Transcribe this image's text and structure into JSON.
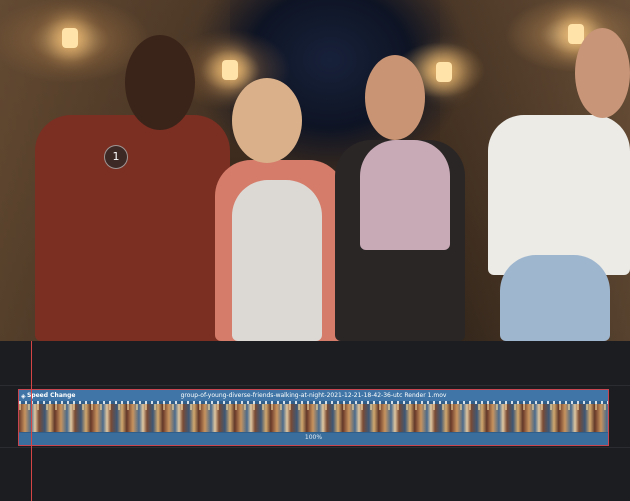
{
  "viewer": {
    "marker_label": "1"
  },
  "timeline": {
    "clip": {
      "speed_label": "Speed Change",
      "file_name": "group-of-young-diverse-friends-walking-at-night-2021-12-21-18-42-36-utc Render 1.mov",
      "speed_percent": "100%",
      "fx_icon": "fx-icon"
    }
  },
  "colors": {
    "clip_border": "#c9454f",
    "clip_body": "#2f5f8a",
    "clip_header": "#3f76a7",
    "playhead": "#d64545",
    "timeline_bg": "#1c1d21"
  }
}
